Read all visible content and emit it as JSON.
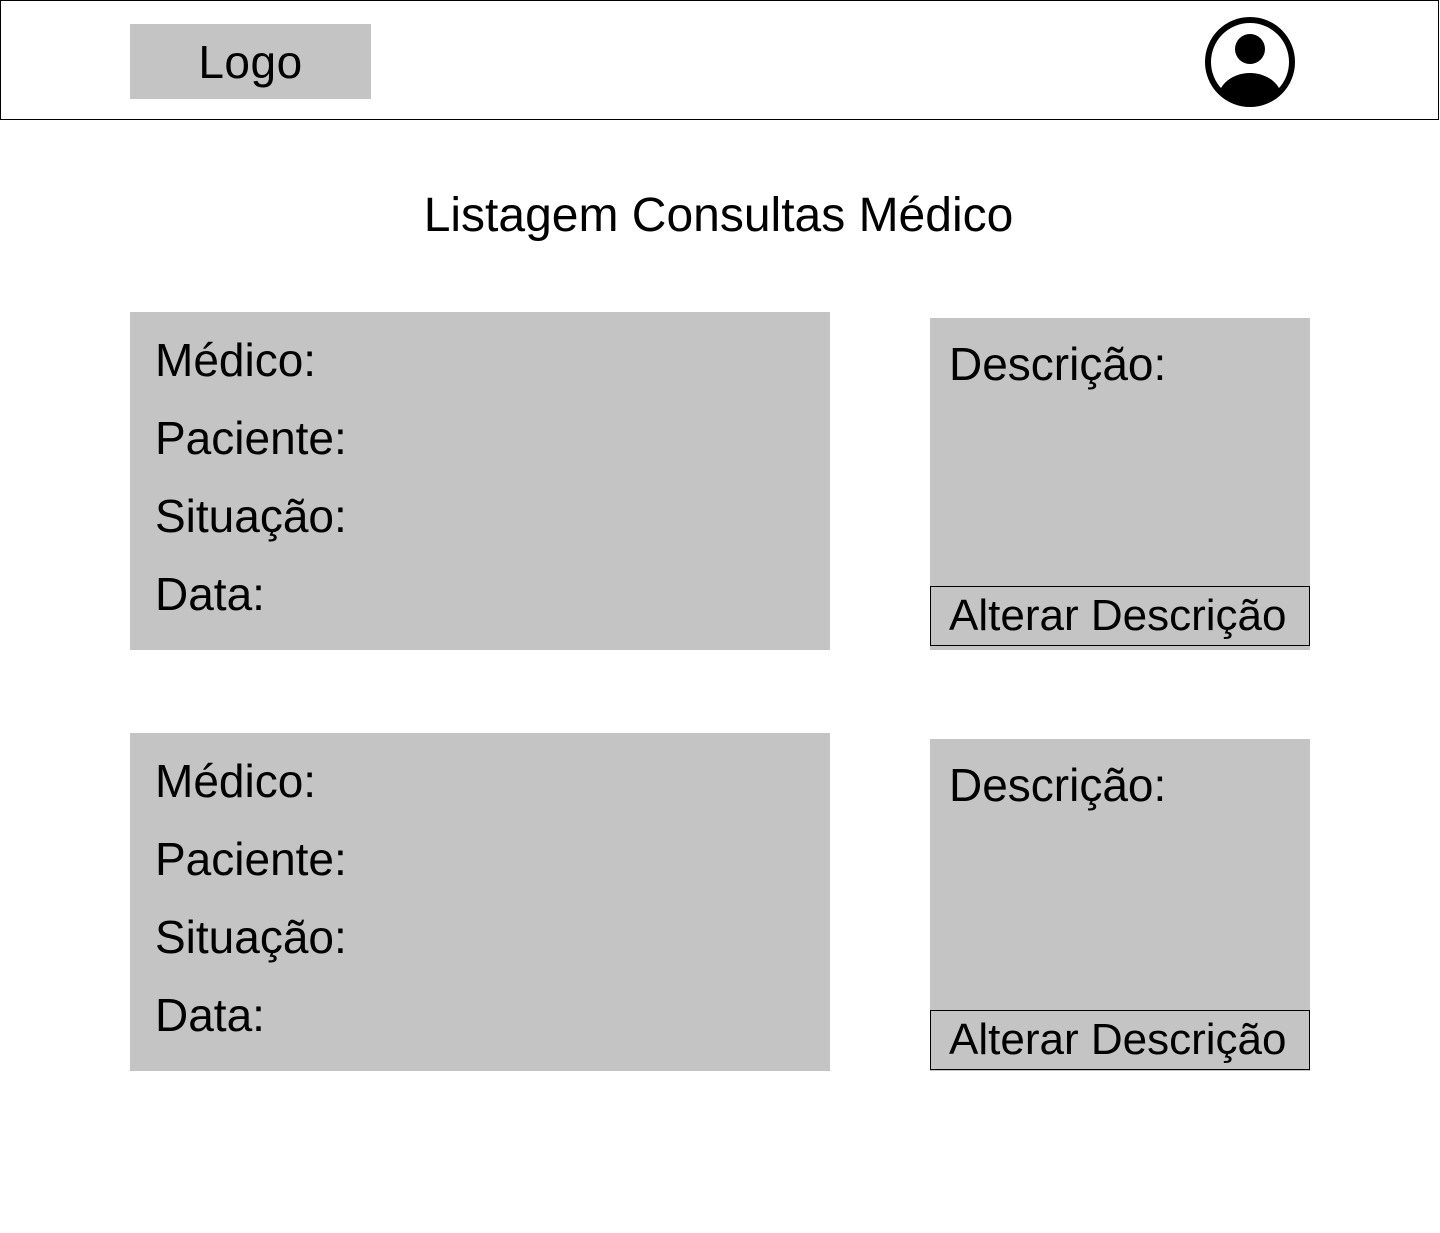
{
  "header": {
    "logo_label": "Logo",
    "avatar_icon": "user-circle-icon"
  },
  "main": {
    "title": "Listagem Consultas Médico",
    "consultations": [
      {
        "medico_label": "Médico:",
        "paciente_label": "Paciente:",
        "situacao_label": "Situação:",
        "data_label": "Data:",
        "descricao_label": "Descrição:",
        "alterar_button": "Alterar Descrição"
      },
      {
        "medico_label": "Médico:",
        "paciente_label": "Paciente:",
        "situacao_label": "Situação:",
        "data_label": "Data:",
        "descricao_label": "Descrição:",
        "alterar_button": "Alterar Descrição"
      }
    ]
  },
  "colors": {
    "card_gray": "#c4c4c4",
    "border": "#000000",
    "background": "#ffffff"
  }
}
